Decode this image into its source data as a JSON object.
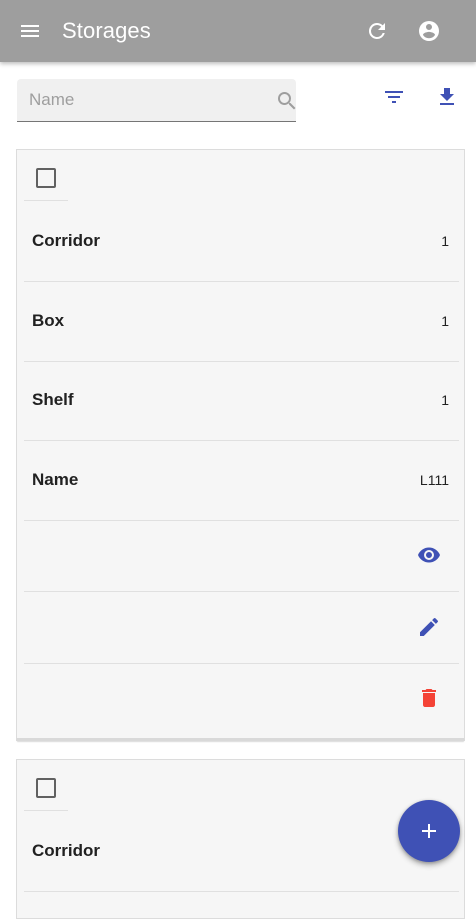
{
  "toolbar": {
    "title": "Storages",
    "menu_icon": "menu-icon",
    "refresh_icon": "refresh-icon",
    "account_icon": "account-circle-icon",
    "background": "#9e9e9e"
  },
  "search": {
    "placeholder": "Name",
    "value": "",
    "icon": "search-icon"
  },
  "actions": {
    "filter_icon": "filter-icon",
    "download_icon": "download-icon",
    "accent": "#3f51b5"
  },
  "cards": [
    {
      "rows": [
        {
          "label": "Corridor",
          "value": "1"
        },
        {
          "label": "Box",
          "value": "1"
        },
        {
          "label": "Shelf",
          "value": "1"
        },
        {
          "label": "Name",
          "value": "L111"
        }
      ],
      "row_actions": [
        {
          "icon": "eye-icon",
          "color": "#3f51b5"
        },
        {
          "icon": "pencil-icon",
          "color": "#3f51b5"
        },
        {
          "icon": "trash-icon",
          "color": "#f44336"
        }
      ]
    },
    {
      "rows": [
        {
          "label": "Corridor",
          "value": ""
        }
      ]
    }
  ],
  "fab": {
    "icon": "plus-icon",
    "color": "#3f51b5"
  }
}
